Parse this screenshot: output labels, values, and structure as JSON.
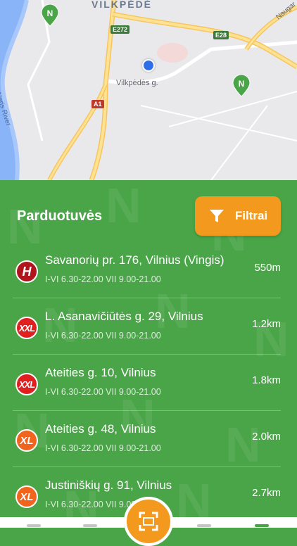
{
  "map": {
    "district": "VILKPĖDĖ",
    "street_label": "Vilkpėdės g.",
    "river_label": "Neris River",
    "top_right_street": "Naugar",
    "shields": [
      "E272",
      "E28",
      "A1"
    ]
  },
  "panel": {
    "title": "Parduotuvės",
    "filter_label": "Filtrai"
  },
  "stores": [
    {
      "badge": "H",
      "address": "Savanorių pr. 176, Vilnius (Vingis)",
      "hours": "I-VI 6.30-22.00 VII 9.00-21.00",
      "distance": "550m"
    },
    {
      "badge": "XXL",
      "address": "L. Asanavičiūtės g. 29, Vilnius",
      "hours": "I-VI 6.30-22.00 VII 9.00-21.00",
      "distance": "1.2km"
    },
    {
      "badge": "XXL",
      "address": "Ateities g. 10, Vilnius",
      "hours": "I-VI 6.30-22.00 VII 9.00-21.00",
      "distance": "1.8km"
    },
    {
      "badge": "XL",
      "address": "Ateities g. 48, Vilnius",
      "hours": "I-VI 6.30-22.00 VII 9.00-21.00",
      "distance": "2.0km"
    },
    {
      "badge": "XL",
      "address": "Justiniškių g. 91, Vilnius",
      "hours": "I-VI 6.30-22.00 VII 9.00-21.00",
      "distance": "2.7km"
    }
  ],
  "colors": {
    "brand_green": "#4aa548",
    "accent_orange": "#f39a1e",
    "badge_H": "#b0141c",
    "badge_XXL": "#e02020",
    "badge_XL": "#f0641e"
  },
  "icons": {
    "filter": "filter-funnel-icon",
    "scan": "scan-frame-icon",
    "location": "current-location-icon",
    "store_pin": "store-pin-icon"
  }
}
